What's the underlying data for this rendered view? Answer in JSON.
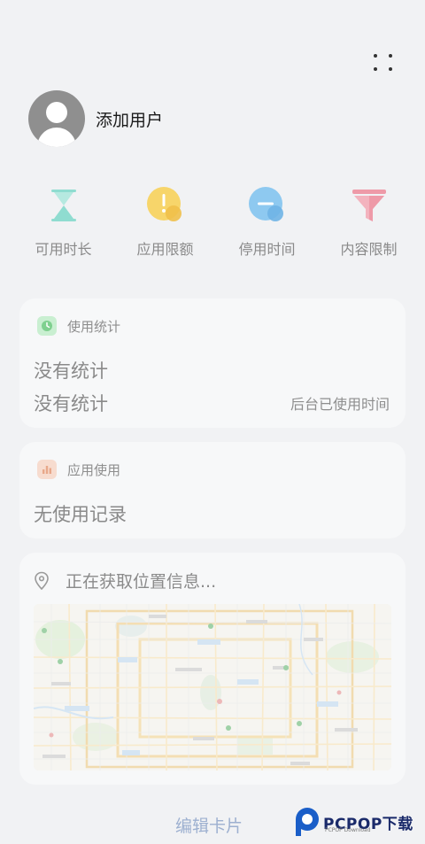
{
  "header": {
    "more_icon": "more-dots-icon"
  },
  "user": {
    "name": "添加用户",
    "avatar_icon": "default-avatar-icon"
  },
  "features": [
    {
      "label": "可用时长",
      "icon": "hourglass-icon",
      "color": "#8fdcd0"
    },
    {
      "label": "应用限额",
      "icon": "app-limit-icon",
      "color": "#f7d56a"
    },
    {
      "label": "停用时间",
      "icon": "downtime-icon",
      "color": "#8ec9f0"
    },
    {
      "label": "内容限制",
      "icon": "content-filter-icon",
      "color": "#ee9aa8"
    }
  ],
  "usage_stats": {
    "title": "使用统计",
    "icon": "clock-icon",
    "accent": "#8ed99c",
    "line1": "没有统计",
    "line2": "没有统计",
    "right_label": "后台已使用时间"
  },
  "app_usage": {
    "title": "应用使用",
    "icon": "bar-chart-icon",
    "accent": "#f3c9b4",
    "empty": "无使用记录"
  },
  "location": {
    "icon": "location-pin-icon",
    "status": "正在获取位置信息..."
  },
  "footer": {
    "edit_label": "编辑卡片"
  },
  "watermark": {
    "brand": "PCPOP下载",
    "sub": "PCPOP Download"
  }
}
